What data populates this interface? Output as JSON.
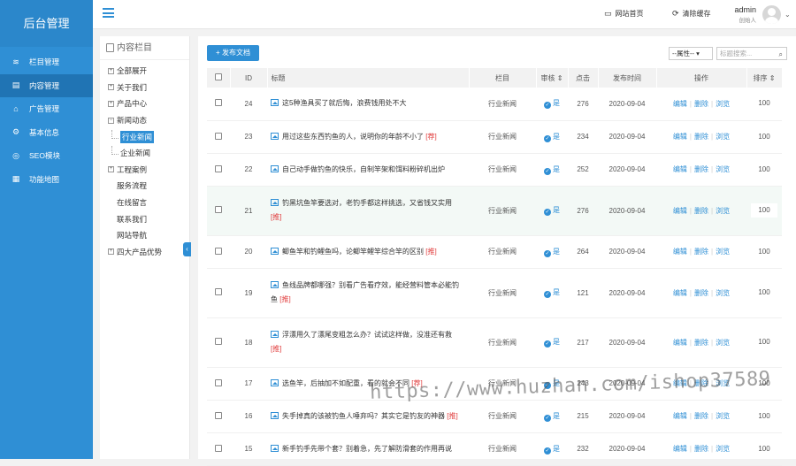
{
  "brand": "后台管理",
  "sidebar": {
    "items": [
      {
        "label": "栏目管理",
        "icon": "layers-icon",
        "glyph": "≋"
      },
      {
        "label": "内容管理",
        "icon": "document-icon",
        "glyph": "▤"
      },
      {
        "label": "广告管理",
        "icon": "ad-icon",
        "glyph": "⌂"
      },
      {
        "label": "基本信息",
        "icon": "gear-icon",
        "glyph": "⚙"
      },
      {
        "label": "SEO模块",
        "icon": "seo-icon",
        "glyph": "◎"
      },
      {
        "label": "功能地图",
        "icon": "grid-icon",
        "glyph": "▦"
      }
    ],
    "active_index": 1
  },
  "topbar": {
    "site_home": "网站首页",
    "clear_cache": "清除缓存",
    "user_name": "admin",
    "user_role": "创始人"
  },
  "tree": {
    "title": "内容栏目",
    "items": [
      {
        "label": "全部展开",
        "type": "plus"
      },
      {
        "label": "关于我们",
        "type": "plus"
      },
      {
        "label": "产品中心",
        "type": "plus"
      },
      {
        "label": "新闻动态",
        "type": "minus"
      },
      {
        "label": "行业新闻",
        "type": "child",
        "selected": true
      },
      {
        "label": "企业新闻",
        "type": "child"
      },
      {
        "label": "工程案例",
        "type": "plus"
      },
      {
        "label": "服务流程",
        "type": "leaf"
      },
      {
        "label": "在线留言",
        "type": "leaf"
      },
      {
        "label": "联系我们",
        "type": "leaf"
      },
      {
        "label": "网站导航",
        "type": "leaf"
      },
      {
        "label": "四大产品优势",
        "type": "plus"
      }
    ]
  },
  "toolbar": {
    "add_label": "+ 发布文档",
    "attr_select": "--属性--",
    "search_placeholder": "标题搜索..."
  },
  "table": {
    "headers": [
      "",
      "ID",
      "标题",
      "栏目",
      "审核",
      "点击",
      "发布时间",
      "操作",
      "排序"
    ],
    "op_edit": "编辑",
    "op_delete": "删除",
    "op_view": "浏览",
    "rows": [
      {
        "id": "24",
        "title": "这5种渔具买了就后悔，浪费钱用处不大",
        "tag": "",
        "column": "行业新闻",
        "status": "是",
        "clicks": "276",
        "date": "2020-09-04",
        "sort": "100"
      },
      {
        "id": "23",
        "title": "用过这些东西钓鱼的人，说明你的年龄不小了",
        "tag": "[荐]",
        "column": "行业新闻",
        "status": "是",
        "clicks": "234",
        "date": "2020-09-04",
        "sort": "100"
      },
      {
        "id": "22",
        "title": "自己动手做钓鱼的快乐，自制竿架和饵料粉碎机出炉",
        "tag": "",
        "column": "行业新闻",
        "status": "是",
        "clicks": "252",
        "date": "2020-09-04",
        "sort": "100"
      },
      {
        "id": "21",
        "title": "钓黑坑鱼竿要选对，老钓手都这样挑选，又省钱又实用",
        "tag": "[推]",
        "column": "行业新闻",
        "status": "是",
        "clicks": "276",
        "date": "2020-09-04",
        "sort": "100"
      },
      {
        "id": "20",
        "title": "鲫鱼竿和钓鲤鱼吗，论鲫竿鲤竿综合竿的区别",
        "tag": "[推]",
        "column": "行业新闻",
        "status": "是",
        "clicks": "264",
        "date": "2020-09-04",
        "sort": "100"
      },
      {
        "id": "19",
        "title": "鱼线品牌都哪强？别看广告看疗效，能经营料管本必能钓鱼",
        "tag": "[推]",
        "column": "行业新闻",
        "status": "是",
        "clicks": "121",
        "date": "2020-09-04",
        "sort": "100"
      },
      {
        "id": "18",
        "title": "浮漂用久了漂尾变粗怎么办？试试这样做，没准还有救",
        "tag": "[推]",
        "column": "行业新闻",
        "status": "是",
        "clicks": "217",
        "date": "2020-09-04",
        "sort": "100"
      },
      {
        "id": "17",
        "title": "选鱼竿，后抽加不如配重，看的就会不同",
        "tag": "[荐]",
        "column": "行业新闻",
        "status": "是",
        "clicks": "243",
        "date": "2020-09-04",
        "sort": "100"
      },
      {
        "id": "16",
        "title": "失手掉真的该被钓鱼人唾弃吗？其实它是钓友的神器",
        "tag": "[推]",
        "column": "行业新闻",
        "status": "是",
        "clicks": "215",
        "date": "2020-09-04",
        "sort": "100"
      },
      {
        "id": "15",
        "title": "新手钓手先带个套？别着急，先了解防滑套的作用再说",
        "tag": "",
        "column": "行业新闻",
        "status": "是",
        "clicks": "232",
        "date": "2020-09-04",
        "sort": "100"
      }
    ]
  },
  "watermark": "https://www.huzhan.com/ishop37589",
  "colors": {
    "primary": "#2f8fd5",
    "sidebar": "#2f8fd5",
    "active": "#2074b4",
    "tag": "#e03a3a",
    "highlight_row": "#f3f9f6"
  }
}
